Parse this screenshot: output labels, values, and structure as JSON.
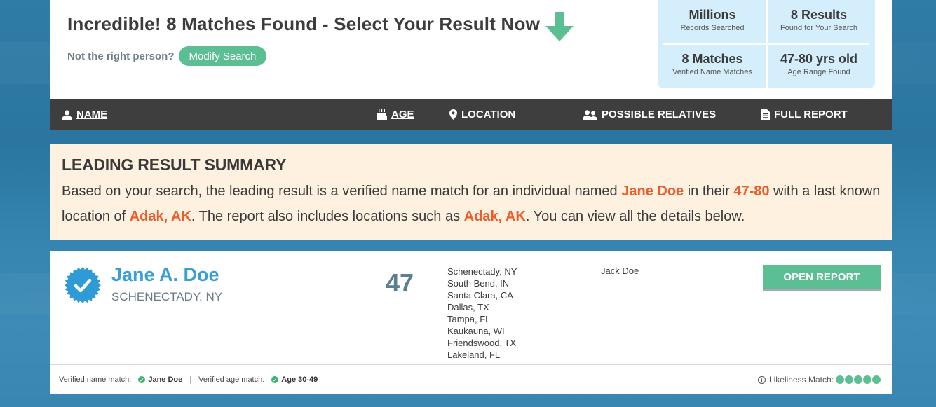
{
  "header": {
    "headline": "Incredible! 8 Matches Found - Select Your Result Now",
    "not_right_person": "Not the right person?",
    "modify_search_label": "Modify Search"
  },
  "stats": [
    {
      "value": "Millions",
      "label": "Records Searched"
    },
    {
      "value": "8 Results",
      "label": "Found for Your Search"
    },
    {
      "value": "8 Matches",
      "label": "Verified Name Matches"
    },
    {
      "value": "47-80 yrs old",
      "label": "Age Range Found"
    }
  ],
  "columns": {
    "name": "NAME",
    "age": "AGE",
    "location": "LOCATION",
    "relatives": "POSSIBLE RELATIVES",
    "report": "FULL REPORT"
  },
  "summary": {
    "title": "LEADING RESULT SUMMARY",
    "t1": "Based on your search, the leading result is a verified name match for an individual named ",
    "name": "Jane Doe",
    "t2": " in their ",
    "age_range": "47-80",
    "t3": " with a last known location of ",
    "last_location": "Adak, AK",
    "t4": ". The report also includes locations such as ",
    "other_location": "Adak, AK",
    "t5": ". You can view all the details below."
  },
  "result": {
    "name": "Jane A. Doe",
    "location": "SCHENECTADY, NY",
    "age": "47",
    "locations": [
      "Schenectady, NY",
      "South Bend, IN",
      "Santa Clara, CA",
      "Dallas, TX",
      "Tampa, FL",
      "Kaukauna, WI",
      "Friendswood, TX",
      "Lakeland, FL"
    ],
    "relative": "Jack Doe",
    "open_report_label": "OPEN REPORT",
    "footer": {
      "name_match_label": "Verified name match:",
      "name_match_value": "Jane Doe",
      "separator": "|",
      "age_match_label": "Verified age match:",
      "age_match_value": "Age 30-49",
      "likeliness_label": "Likeliness Match:",
      "likeliness_score": 5,
      "likeliness_max": 5
    }
  },
  "colors": {
    "accent_green": "#5bbf93",
    "highlight_orange": "#ef5a2a",
    "name_blue": "#3a9fd4",
    "header_bar": "#3e3e3e",
    "summary_bg": "#fef1e0",
    "stats_bg": "#d4eefb"
  }
}
